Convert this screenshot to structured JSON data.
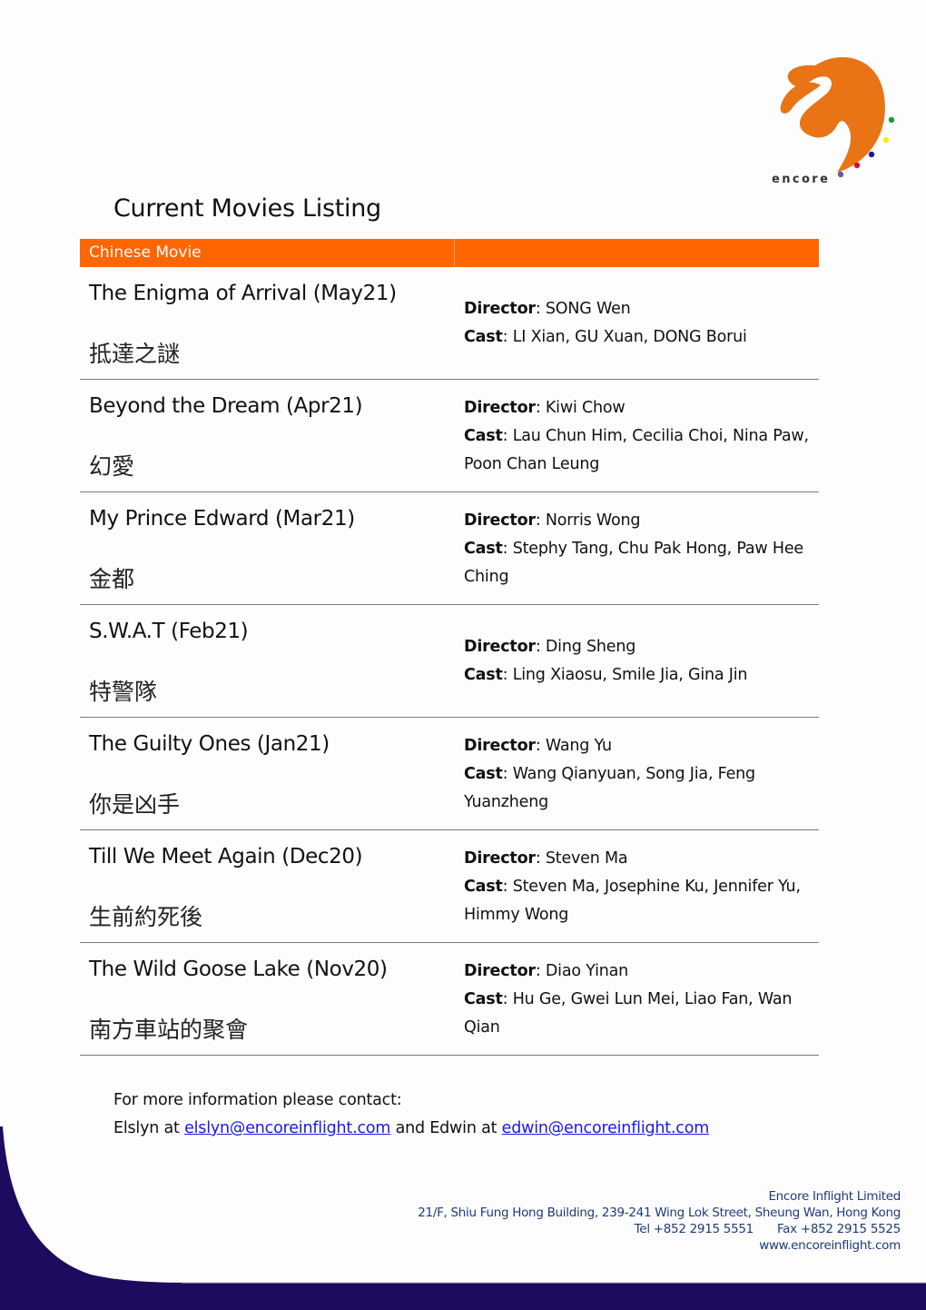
{
  "brand": {
    "logo_text": "encore",
    "colors": {
      "orange": "#e87415",
      "header_orange": "#ff6600",
      "navy": "#1e0a5e",
      "dot_green": "#1a9a3a",
      "dot_yellow": "#f0f000",
      "dot_blue": "#1a1a8c",
      "dot_red": "#e01020",
      "dot_purple": "#6a5a9a"
    }
  },
  "page_title": "Current Movies Listing",
  "table": {
    "header": {
      "category": "Chinese Movie",
      "right": ""
    },
    "director_label": "Director",
    "cast_label": "Cast",
    "rows": [
      {
        "title": "The Enigma of Arrival (May21)",
        "chinese": "抵達之謎",
        "director": "SONG Wen",
        "cast": "LI Xian, GU Xuan, DONG Borui"
      },
      {
        "title": "Beyond the Dream (Apr21)",
        "chinese": "幻愛",
        "director": "Kiwi Chow",
        "cast": "Lau Chun Him, Cecilia Choi, Nina Paw, Poon Chan Leung"
      },
      {
        "title": "My Prince Edward (Mar21)",
        "chinese": "金都",
        "director": "Norris Wong",
        "cast": "Stephy Tang, Chu Pak Hong, Paw Hee Ching"
      },
      {
        "title": "S.W.A.T (Feb21)",
        "chinese": "特警隊",
        "director": "Ding Sheng",
        "cast": "Ling Xiaosu, Smile Jia, Gina Jin"
      },
      {
        "title": "The Guilty Ones (Jan21)",
        "chinese": "你是凶手",
        "director": "Wang Yu",
        "cast": "Wang Qianyuan, Song Jia, Feng Yuanzheng"
      },
      {
        "title": "Till We Meet Again (Dec20)",
        "chinese": "生前約死後",
        "director": "Steven Ma",
        "cast": "Steven Ma, Josephine Ku, Jennifer Yu, Himmy Wong"
      },
      {
        "title": "The Wild Goose Lake (Nov20)",
        "chinese": "南方車站的聚會",
        "director": "Diao Yinan",
        "cast": "Hu Ge, Gwei Lun Mei, Liao Fan, Wan Qian"
      }
    ]
  },
  "contact": {
    "intro": "For more information please contact:",
    "person1_prefix": "Elslyn at ",
    "person1_email": "elslyn@encoreinflight.com",
    "joiner": " and Edwin at ",
    "person2_email": "edwin@encoreinflight.com"
  },
  "footer": {
    "company": "Encore Inflight Limited",
    "address": "21/F, Shiu Fung Hong Building, 239-241 Wing Lok Street, Sheung Wan, Hong Kong",
    "tel": "Tel +852 2915 5551",
    "fax": "Fax +852 2915 5525",
    "website": "www.encoreinflight.com"
  }
}
